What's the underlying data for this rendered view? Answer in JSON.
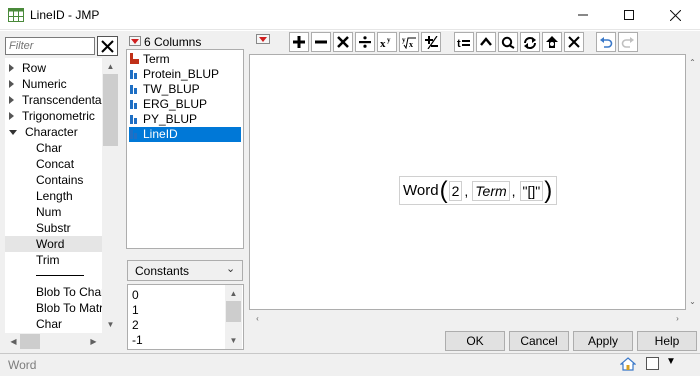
{
  "window": {
    "title": "LineID - JMP",
    "minimize": "—",
    "maximize": "☐",
    "close": "✕"
  },
  "functions": {
    "filter_placeholder": "Filter",
    "items": [
      {
        "label": "Row",
        "type": "collapsed"
      },
      {
        "label": "Numeric",
        "type": "collapsed"
      },
      {
        "label": "Transcendental",
        "type": "collapsed"
      },
      {
        "label": "Trigonometric",
        "type": "collapsed"
      },
      {
        "label": "Character",
        "type": "expanded"
      },
      {
        "label": "Char",
        "type": "child"
      },
      {
        "label": "Concat",
        "type": "child"
      },
      {
        "label": "Contains",
        "type": "child"
      },
      {
        "label": "Length",
        "type": "child"
      },
      {
        "label": "Num",
        "type": "child"
      },
      {
        "label": "Substr",
        "type": "child"
      },
      {
        "label": "Word",
        "type": "child",
        "selected": true
      },
      {
        "label": "Trim",
        "type": "child"
      },
      {
        "label": "separator",
        "type": "separator"
      },
      {
        "label": "Blob To Char",
        "type": "child"
      },
      {
        "label": "Blob To Matrix",
        "type": "child"
      },
      {
        "label": "Char",
        "type": "child"
      }
    ]
  },
  "columns": {
    "header": "6 Columns",
    "items": [
      {
        "label": "Term",
        "icon": "character-column-icon"
      },
      {
        "label": "Protein_BLUP",
        "icon": "numeric-column-icon"
      },
      {
        "label": "TW_BLUP",
        "icon": "numeric-column-icon"
      },
      {
        "label": "ERG_BLUP",
        "icon": "numeric-column-icon"
      },
      {
        "label": "PY_BLUP",
        "icon": "numeric-column-icon"
      },
      {
        "label": "LineID",
        "icon": "numeric-column-icon",
        "selected": true
      }
    ]
  },
  "constants": {
    "selected": "Constants",
    "items": [
      "0",
      "1",
      "2",
      "-1"
    ]
  },
  "formula": {
    "function": "Word",
    "args": [
      "2",
      "Term",
      "\"[]\""
    ]
  },
  "buttons": {
    "ok": "OK",
    "cancel": "Cancel",
    "apply": "Apply",
    "help": "Help"
  },
  "status": {
    "text": "Word"
  },
  "colors": {
    "selection": "#0078d7",
    "red_triangle": "#d02020",
    "undo_blue": "#3a78c8"
  }
}
